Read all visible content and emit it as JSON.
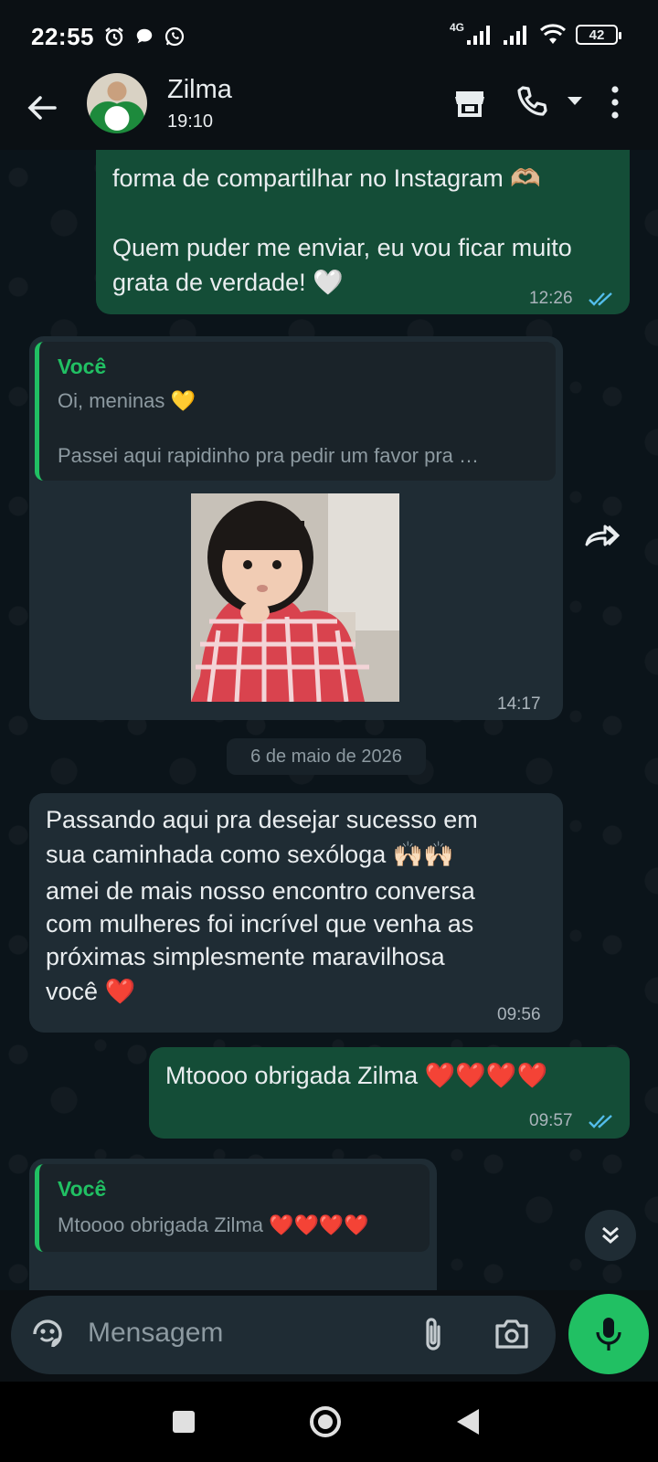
{
  "status_bar": {
    "time": "22:55",
    "network": "4G",
    "battery": "42"
  },
  "header": {
    "contact_name": "Zilma",
    "contact_status": "19:10"
  },
  "messages": {
    "m1": {
      "line1": "forma de compartilhar no Instagram 🫶🏼",
      "line2": "Quem puder me enviar, eu vou ficar muito",
      "line3": "grata de verdade! 🤍",
      "time": "12:26"
    },
    "m2": {
      "quote_author": "Você",
      "quote_line1": "Oi, meninas 💛",
      "quote_line2": "Passei aqui rapidinho pra pedir um favor pra …",
      "time": "14:17"
    },
    "date_separator": "6 de maio de 2026",
    "m3": {
      "lines": [
        "Passando aqui pra desejar sucesso em",
        "sua caminhada como sexóloga 🙌🏻🙌🏻",
        "amei de mais nosso encontro conversa",
        "com mulheres foi incrível que venha as",
        "próximas simplesmente maravilhosa",
        "você ❤️"
      ],
      "time": "09:56"
    },
    "m4": {
      "text": "Mtoooo obrigada Zilma ❤️❤️❤️❤️",
      "time": "09:57"
    },
    "m5": {
      "quote_author": "Você",
      "quote_line1": "Mtoooo obrigada Zilma ❤️❤️❤️❤️"
    }
  },
  "composer": {
    "placeholder": "Mensagem"
  },
  "colors": {
    "outgoing": "#144d37",
    "incoming": "#1f2c34",
    "accent": "#21c063",
    "read_ticks": "#53bdeb"
  }
}
